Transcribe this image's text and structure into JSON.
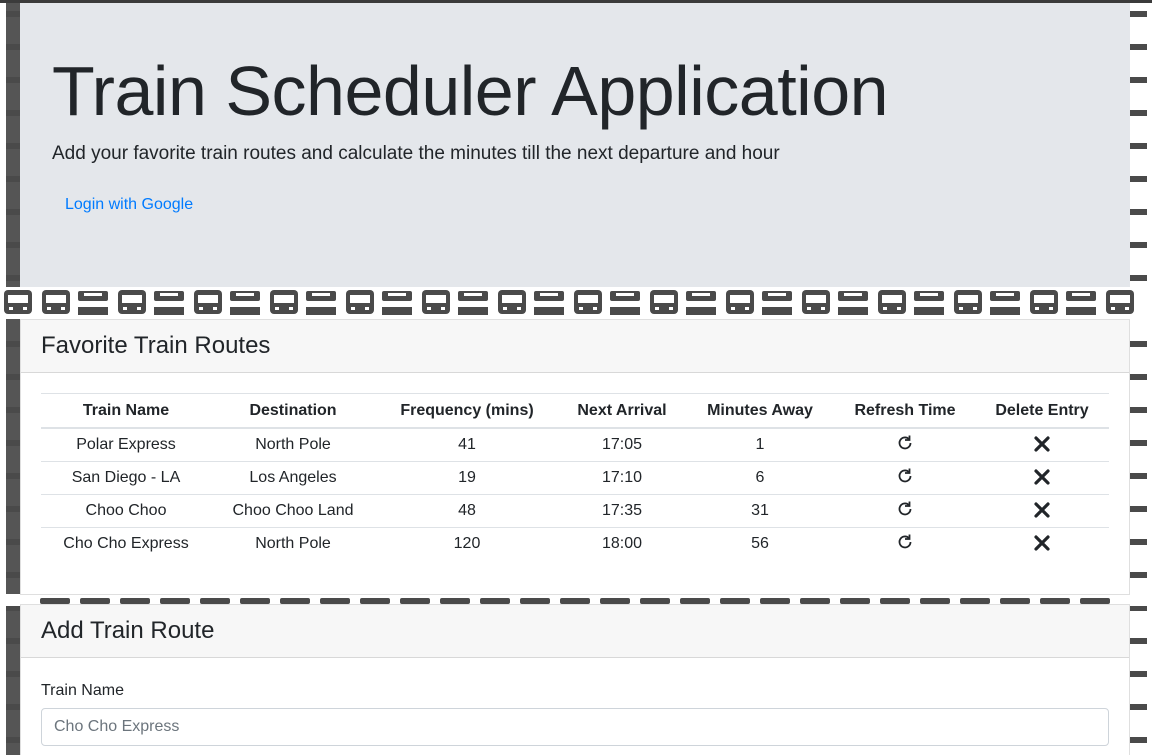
{
  "header": {
    "title": "Train Scheduler Application",
    "lead": "Add your favorite train routes and calculate the minutes till the next departure and hour",
    "login_label": "Login with Google"
  },
  "favorites": {
    "title": "Favorite Train Routes",
    "columns": [
      "Train Name",
      "Destination",
      "Frequency (mins)",
      "Next Arrival",
      "Minutes Away",
      "Refresh Time",
      "Delete Entry"
    ],
    "rows": [
      {
        "name": "Polar Express",
        "destination": "North Pole",
        "frequency": "41",
        "next_arrival": "17:05",
        "minutes_away": "1"
      },
      {
        "name": "San Diego - LA",
        "destination": "Los Angeles",
        "frequency": "19",
        "next_arrival": "17:10",
        "minutes_away": "6"
      },
      {
        "name": "Choo Choo",
        "destination": "Choo Choo Land",
        "frequency": "48",
        "next_arrival": "17:35",
        "minutes_away": "31"
      },
      {
        "name": "Cho Cho Express",
        "destination": "North Pole",
        "frequency": "120",
        "next_arrival": "18:00",
        "minutes_away": "56"
      }
    ],
    "refresh_icon": "refresh-icon",
    "delete_icon": "close-icon"
  },
  "add_route": {
    "title": "Add Train Route",
    "train_name_label": "Train Name",
    "train_name_placeholder": "Cho Cho Express"
  },
  "colors": {
    "jumbotron_bg": "#e4e7eb",
    "link": "#007bff",
    "pattern_icon": "#4a4a4a"
  }
}
